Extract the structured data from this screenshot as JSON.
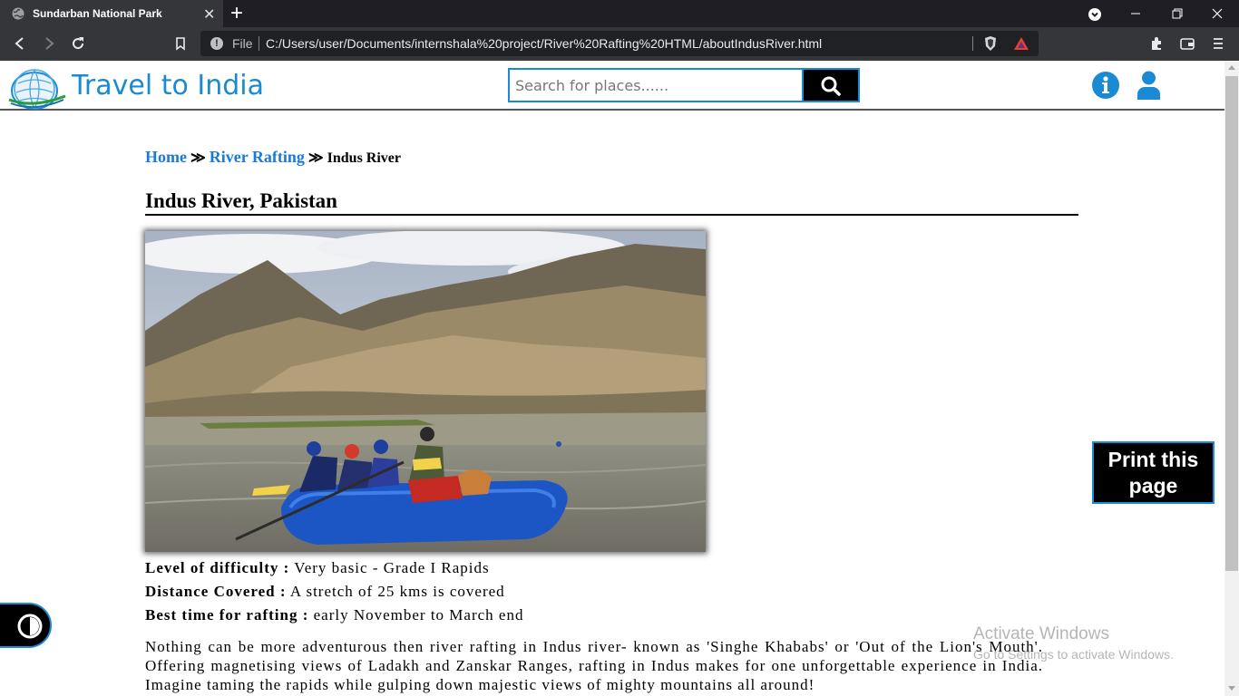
{
  "browser": {
    "tab_title": "Sundarban National Park",
    "tab_close": "✕",
    "new_tab": "+",
    "url_scheme_label": "File",
    "url": "C:/Users/user/Documents/internshala%20project/River%20Rafting%20HTML/aboutIndusRiver.html"
  },
  "site": {
    "title": "Travel to India",
    "search_placeholder": "Search for places......"
  },
  "breadcrumb": {
    "home": "Home",
    "river_rafting": "River Rafting",
    "separator": "≫",
    "current": "Indus River"
  },
  "page": {
    "heading": "Indus River, Pakistan",
    "photo_alt": "Rafting on Indus River"
  },
  "facts": {
    "difficulty_label": "Level of difficulty :",
    "difficulty_value": "Very basic - Grade I Rapids",
    "distance_label": "Distance Covered :",
    "distance_value": "A stretch of 25 kms is covered",
    "best_time_label": "Best time for rafting :",
    "best_time_value": "early November to March end"
  },
  "description": "Nothing can be more adventurous then river rafting in Indus river- known as 'Singhe Khababs' or 'Out of the Lion's Mouth'. Offering magnetising views of Ladakh and Zanskar Ranges, rafting in Indus makes for one unforgettable experience in India. Imagine taming the rapids while gulping down majestic views of mighty mountains all around!",
  "print_button": "Print this page",
  "watermark": {
    "line1": "Activate Windows",
    "line2": "Go to Settings to activate Windows."
  },
  "colors": {
    "brand_blue": "#1a8ad4",
    "link_blue": "#1a7ad9",
    "chrome_dark": "#35363a"
  }
}
